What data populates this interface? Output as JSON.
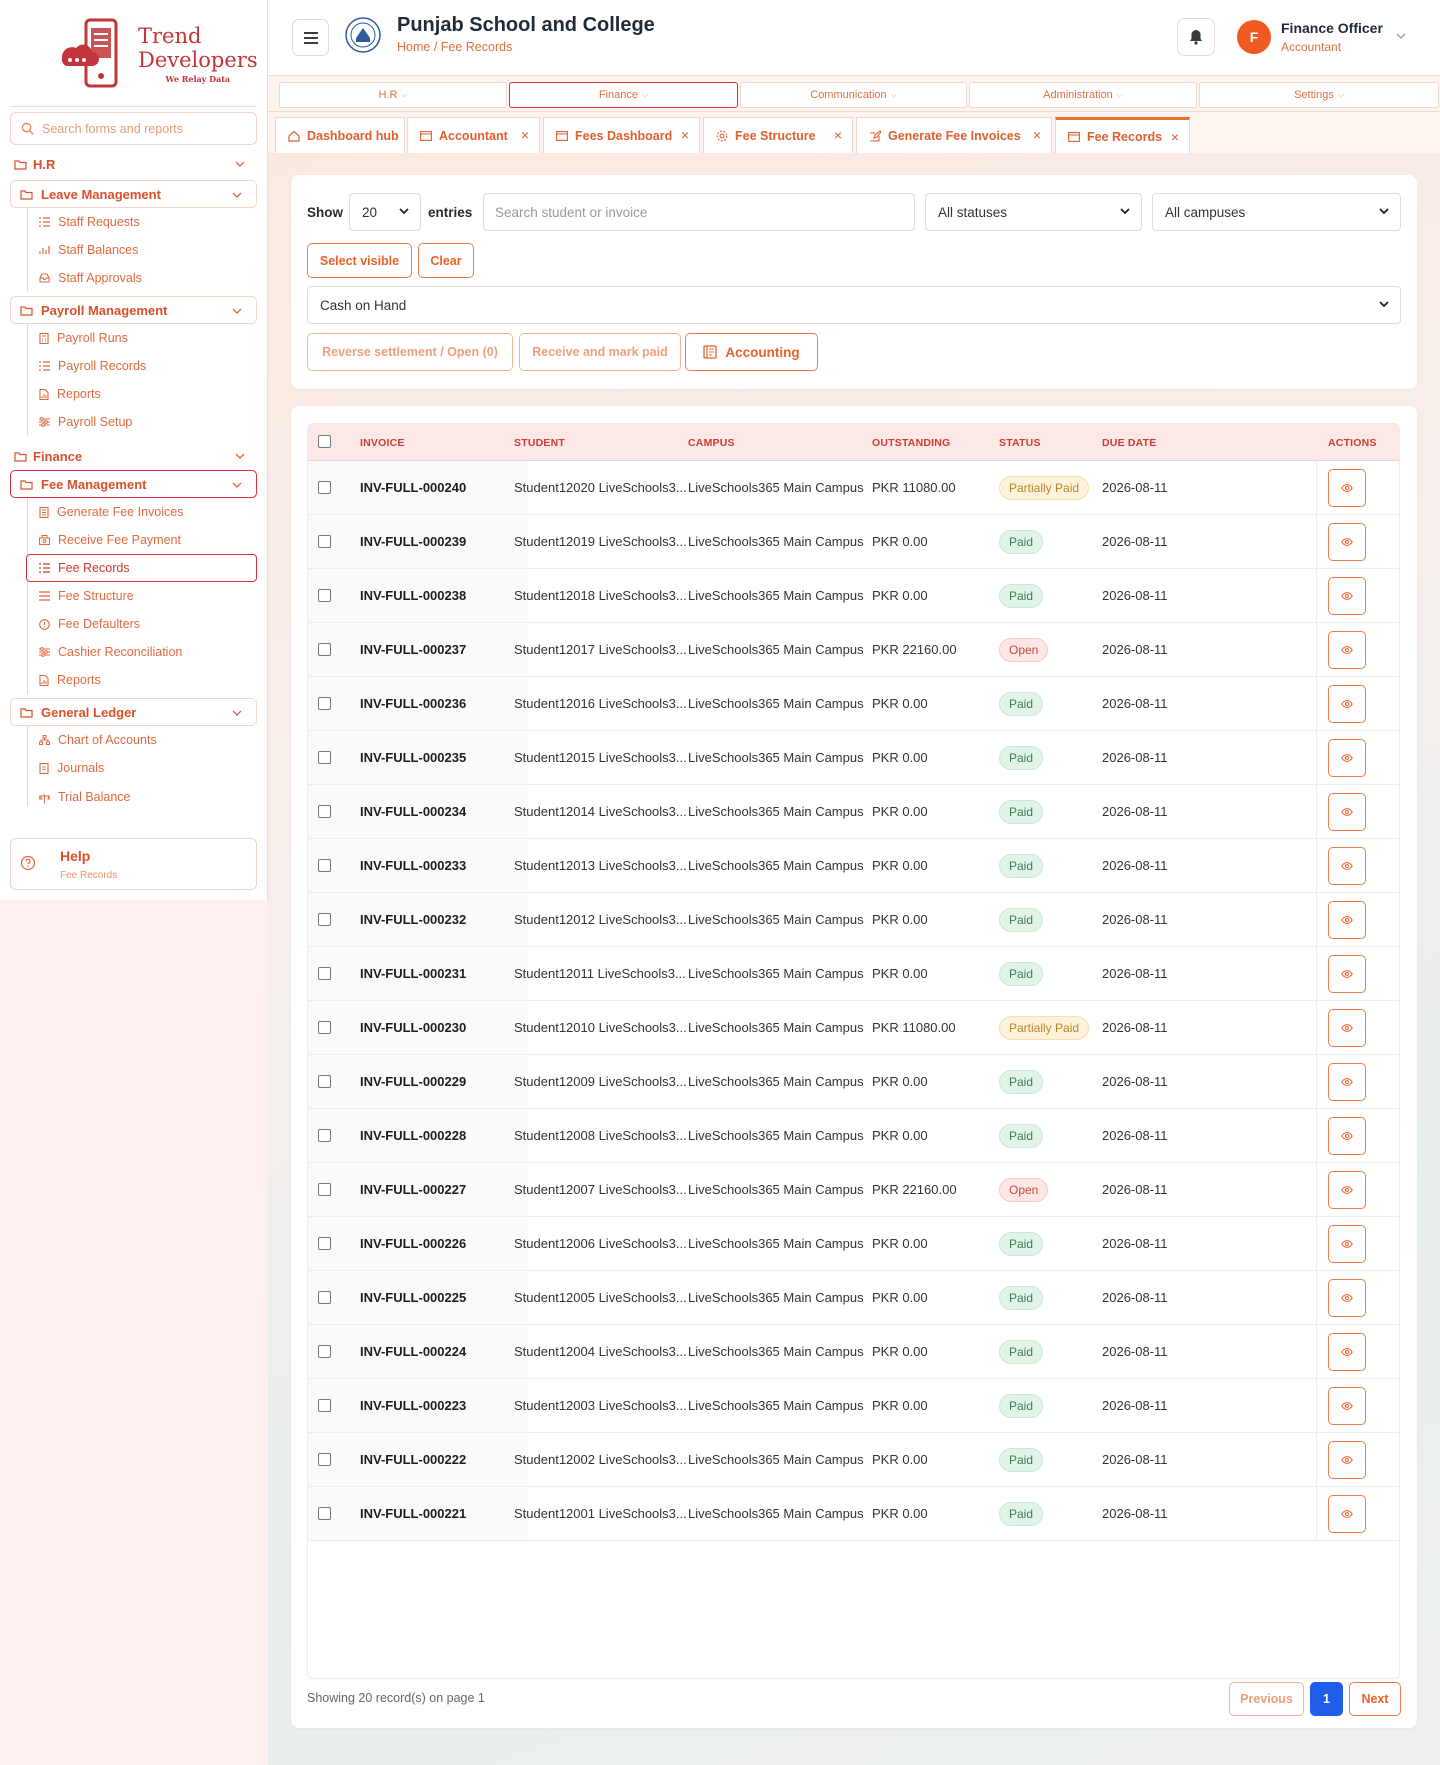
{
  "brand": {
    "line1": "Trend",
    "line2": "Developers",
    "tagline": "We Relay Data"
  },
  "sidebar": {
    "search_placeholder": "Search forms and reports",
    "hr_title": "H.R",
    "leave": {
      "title": "Leave Management",
      "items": [
        "Staff Requests",
        "Staff Balances",
        "Staff Approvals"
      ]
    },
    "payroll": {
      "title": "Payroll Management",
      "items": [
        "Payroll Runs",
        "Payroll Records",
        "Reports",
        "Payroll Setup"
      ]
    },
    "finance_title": "Finance",
    "fee": {
      "title": "Fee Management",
      "items": [
        "Generate Fee Invoices",
        "Receive Fee Payment",
        "Fee Records",
        "Fee Structure",
        "Fee Defaulters",
        "Cashier Reconciliation",
        "Reports"
      ]
    },
    "gl": {
      "title": "General Ledger",
      "items": [
        "Chart of Accounts",
        "Journals",
        "Trial Balance"
      ]
    },
    "help": {
      "title": "Help",
      "subtitle": "Fee Records"
    }
  },
  "header": {
    "school_name": "Punjab School and College",
    "breadcrumb": "Home / Fee Records",
    "user": {
      "initial": "F",
      "name": "Finance Officer",
      "role": "Accountant"
    }
  },
  "top_menu": [
    "H.R",
    "Finance",
    "Communication",
    "Administration",
    "Settings"
  ],
  "tabs": [
    "Dashboard hub",
    "Accountant",
    "Fees Dashboard",
    "Fee Structure",
    "Generate Fee Invoices",
    "Fee Records"
  ],
  "filters": {
    "show_label": "Show",
    "entries_value": "20",
    "entries_label": "entries",
    "search_placeholder": "Search student or invoice",
    "status_value": "All statuses",
    "campus_value": "All campuses",
    "select_visible": "Select visible",
    "clear": "Clear",
    "payment_account": "Cash on Hand",
    "reverse_btn": "Reverse settlement / Open (0)",
    "receive_btn": "Receive and mark paid",
    "accounting_btn": "Accounting"
  },
  "table": {
    "columns": [
      "INVOICE",
      "STUDENT",
      "CAMPUS",
      "OUTSTANDING",
      "STATUS",
      "DUE DATE",
      "ACTIONS"
    ],
    "rows": [
      {
        "invoice": "INV-FULL-000240",
        "student": "Student12020 LiveSchools3...",
        "campus": "LiveSchools365 Main Campus",
        "outstanding": "PKR 11080.00",
        "status": "Partially Paid",
        "due": "2026-08-11"
      },
      {
        "invoice": "INV-FULL-000239",
        "student": "Student12019 LiveSchools3...",
        "campus": "LiveSchools365 Main Campus",
        "outstanding": "PKR 0.00",
        "status": "Paid",
        "due": "2026-08-11"
      },
      {
        "invoice": "INV-FULL-000238",
        "student": "Student12018 LiveSchools3...",
        "campus": "LiveSchools365 Main Campus",
        "outstanding": "PKR 0.00",
        "status": "Paid",
        "due": "2026-08-11"
      },
      {
        "invoice": "INV-FULL-000237",
        "student": "Student12017 LiveSchools3...",
        "campus": "LiveSchools365 Main Campus",
        "outstanding": "PKR 22160.00",
        "status": "Open",
        "due": "2026-08-11"
      },
      {
        "invoice": "INV-FULL-000236",
        "student": "Student12016 LiveSchools3...",
        "campus": "LiveSchools365 Main Campus",
        "outstanding": "PKR 0.00",
        "status": "Paid",
        "due": "2026-08-11"
      },
      {
        "invoice": "INV-FULL-000235",
        "student": "Student12015 LiveSchools3...",
        "campus": "LiveSchools365 Main Campus",
        "outstanding": "PKR 0.00",
        "status": "Paid",
        "due": "2026-08-11"
      },
      {
        "invoice": "INV-FULL-000234",
        "student": "Student12014 LiveSchools3...",
        "campus": "LiveSchools365 Main Campus",
        "outstanding": "PKR 0.00",
        "status": "Paid",
        "due": "2026-08-11"
      },
      {
        "invoice": "INV-FULL-000233",
        "student": "Student12013 LiveSchools3...",
        "campus": "LiveSchools365 Main Campus",
        "outstanding": "PKR 0.00",
        "status": "Paid",
        "due": "2026-08-11"
      },
      {
        "invoice": "INV-FULL-000232",
        "student": "Student12012 LiveSchools3...",
        "campus": "LiveSchools365 Main Campus",
        "outstanding": "PKR 0.00",
        "status": "Paid",
        "due": "2026-08-11"
      },
      {
        "invoice": "INV-FULL-000231",
        "student": "Student12011 LiveSchools3...",
        "campus": "LiveSchools365 Main Campus",
        "outstanding": "PKR 0.00",
        "status": "Paid",
        "due": "2026-08-11"
      },
      {
        "invoice": "INV-FULL-000230",
        "student": "Student12010 LiveSchools3...",
        "campus": "LiveSchools365 Main Campus",
        "outstanding": "PKR 11080.00",
        "status": "Partially Paid",
        "due": "2026-08-11"
      },
      {
        "invoice": "INV-FULL-000229",
        "student": "Student12009 LiveSchools3...",
        "campus": "LiveSchools365 Main Campus",
        "outstanding": "PKR 0.00",
        "status": "Paid",
        "due": "2026-08-11"
      },
      {
        "invoice": "INV-FULL-000228",
        "student": "Student12008 LiveSchools3...",
        "campus": "LiveSchools365 Main Campus",
        "outstanding": "PKR 0.00",
        "status": "Paid",
        "due": "2026-08-11"
      },
      {
        "invoice": "INV-FULL-000227",
        "student": "Student12007 LiveSchools3...",
        "campus": "LiveSchools365 Main Campus",
        "outstanding": "PKR 22160.00",
        "status": "Open",
        "due": "2026-08-11"
      },
      {
        "invoice": "INV-FULL-000226",
        "student": "Student12006 LiveSchools3...",
        "campus": "LiveSchools365 Main Campus",
        "outstanding": "PKR 0.00",
        "status": "Paid",
        "due": "2026-08-11"
      },
      {
        "invoice": "INV-FULL-000225",
        "student": "Student12005 LiveSchools3...",
        "campus": "LiveSchools365 Main Campus",
        "outstanding": "PKR 0.00",
        "status": "Paid",
        "due": "2026-08-11"
      },
      {
        "invoice": "INV-FULL-000224",
        "student": "Student12004 LiveSchools3...",
        "campus": "LiveSchools365 Main Campus",
        "outstanding": "PKR 0.00",
        "status": "Paid",
        "due": "2026-08-11"
      },
      {
        "invoice": "INV-FULL-000223",
        "student": "Student12003 LiveSchools3...",
        "campus": "LiveSchools365 Main Campus",
        "outstanding": "PKR 0.00",
        "status": "Paid",
        "due": "2026-08-11"
      },
      {
        "invoice": "INV-FULL-000222",
        "student": "Student12002 LiveSchools3...",
        "campus": "LiveSchools365 Main Campus",
        "outstanding": "PKR 0.00",
        "status": "Paid",
        "due": "2026-08-11"
      },
      {
        "invoice": "INV-FULL-000221",
        "student": "Student12001 LiveSchools3...",
        "campus": "LiveSchools365 Main Campus",
        "outstanding": "PKR 0.00",
        "status": "Paid",
        "due": "2026-08-11"
      }
    ]
  },
  "pagination": {
    "summary": "Showing 20 record(s) on page 1",
    "previous": "Previous",
    "current": "1",
    "next": "Next"
  },
  "colors": {
    "accent": "#e8622a",
    "active_border": "#d8323a",
    "primary_blue": "#1f5eea"
  }
}
